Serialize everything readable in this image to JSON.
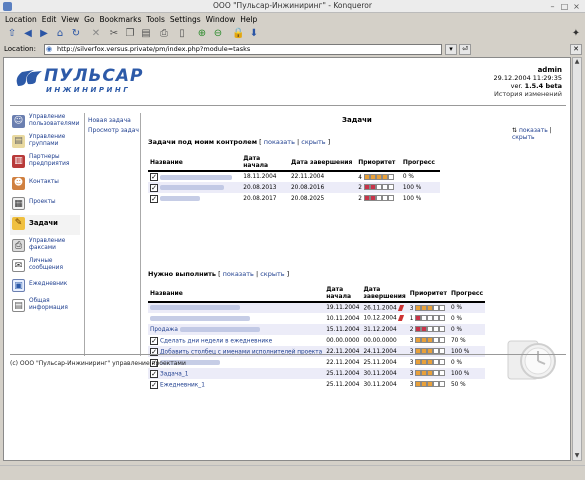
{
  "window": {
    "title": "ООО \"Пульсар-Инжиниринг\" - Konqueror"
  },
  "menu": [
    "Location",
    "Edit",
    "View",
    "Go",
    "Bookmarks",
    "Tools",
    "Settings",
    "Window",
    "Help"
  ],
  "location": {
    "label": "Location:",
    "url": "http://silverfox.versus.private/pm/index.php?module=tasks"
  },
  "brand": {
    "name": "ПУЛЬСАР",
    "sub": "ИНЖИНИРИНГ"
  },
  "user": {
    "name": "admin",
    "datetime": "29.12.2004 11:29:35",
    "version_label": "ver.",
    "version": "1.5.4 beta",
    "history": "История изменений"
  },
  "sidebar": {
    "items": [
      {
        "label": "Управление пользователями",
        "icon": "users-icon"
      },
      {
        "label": "Управление группами",
        "icon": "groups-icon"
      },
      {
        "label": "Партнеры предприятия",
        "icon": "partners-icon"
      },
      {
        "label": "Контакты",
        "icon": "contacts-icon"
      },
      {
        "label": "Проекты",
        "icon": "projects-icon"
      },
      {
        "label": "Задачи",
        "icon": "tasks-icon"
      },
      {
        "label": "Управление факсами",
        "icon": "fax-icon"
      },
      {
        "label": "Личные сообщения",
        "icon": "messages-icon"
      },
      {
        "label": "Ежедневник",
        "icon": "calendar-icon"
      },
      {
        "label": "Общая информация",
        "icon": "info-icon"
      }
    ]
  },
  "subnav": {
    "new_task": "Новая задача",
    "view_tasks": "Просмотр задач"
  },
  "main": {
    "title": "Задачи",
    "show_all": "показать",
    "hide_all": "скрыть",
    "controlled": {
      "heading": "Задачи под моим контролем",
      "show": "показать",
      "hide": "скрыть",
      "columns": [
        "Название",
        "Дата начала",
        "Дата завершения",
        "Приоритет",
        "Прогресс"
      ],
      "rows": [
        {
          "start": "18.11.2004",
          "end": "22.11.2004",
          "priority": "4",
          "progress": "0 %"
        },
        {
          "start": "20.08.2013",
          "end": "20.08.2016",
          "priority": "2",
          "progress": "100 %"
        },
        {
          "start": "20.08.2017",
          "end": "20.08.2025",
          "priority": "2",
          "progress": "100 %"
        }
      ]
    },
    "todo": {
      "heading": "Нужно выполнить",
      "show": "показать",
      "hide": "скрыть",
      "columns": [
        "Название",
        "Дата начала",
        "Дата завершения",
        "Приоритет",
        "Прогресс"
      ],
      "rows": [
        {
          "name": "",
          "start": "19.11.2004",
          "end": "26.11.2004",
          "priority": "3",
          "progress": "0 %"
        },
        {
          "name": "",
          "start": "10.11.2004",
          "end": "10.12.2004",
          "priority": "1",
          "progress": "0 %"
        },
        {
          "name": "Продажа",
          "start": "15.11.2004",
          "end": "31.12.2004",
          "priority": "2",
          "progress": "0 %"
        },
        {
          "name": "Сделать дни недели в ежедневнике",
          "start": "00.00.0000",
          "end": "00.00.0000",
          "priority": "3",
          "progress": "70 %"
        },
        {
          "name": "Добавить столбец с именами исполнителей проекта",
          "start": "22.11.2004",
          "end": "24.11.2004",
          "priority": "3",
          "progress": "100 %"
        },
        {
          "name": "",
          "start": "22.11.2004",
          "end": "25.11.2004",
          "priority": "3",
          "progress": "0 %"
        },
        {
          "name": "Задача_1",
          "start": "25.11.2004",
          "end": "30.11.2004",
          "priority": "3",
          "progress": "100 %"
        },
        {
          "name": "Ежедневник_1",
          "start": "25.11.2004",
          "end": "30.11.2004",
          "priority": "3",
          "progress": "50 %"
        }
      ]
    }
  },
  "footer": "(c) ООО \"Пульсар-Инжиниринг\" управление проектами"
}
